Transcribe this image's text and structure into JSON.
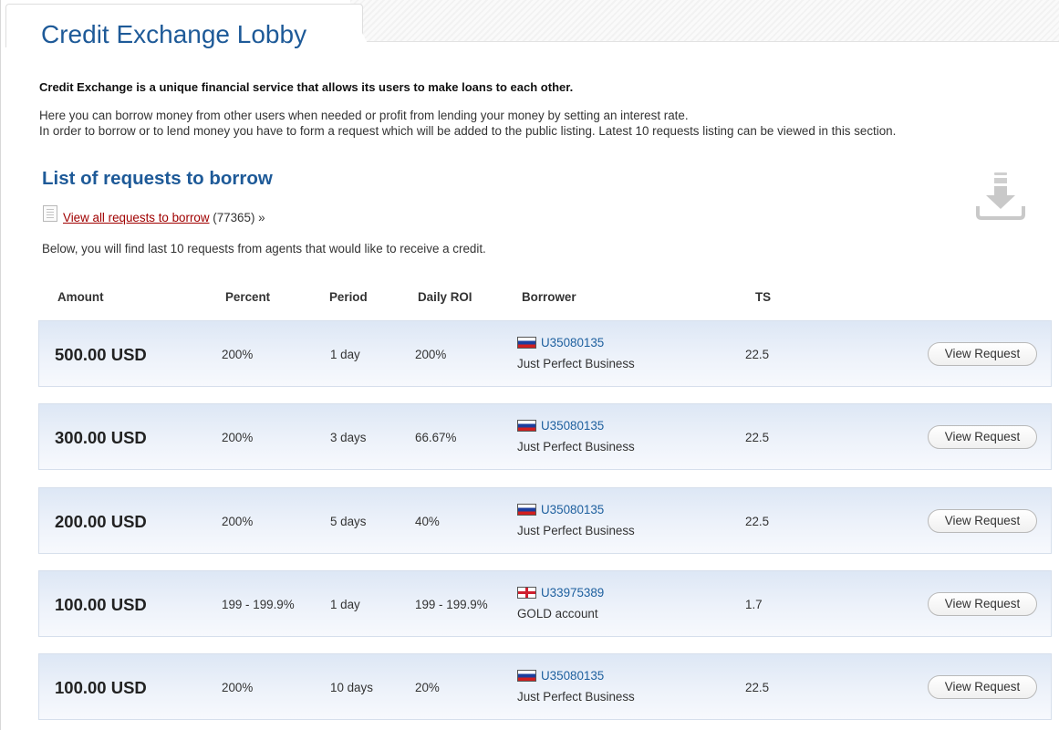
{
  "header": {
    "title": "Credit Exchange Lobby"
  },
  "intro": {
    "bold": "Credit Exchange is a unique financial service that allows its users to make loans to each other.",
    "line1": "Here you can borrow money from other users when needed or profit from lending your money by setting an interest rate.",
    "line2": "In order to borrow or to lend money you have to form a request which will be added to the public listing. Latest 10 requests listing can be viewed in this section."
  },
  "section": {
    "title": "List of requests to borrow",
    "view_all_label": "View all requests to borrow",
    "view_all_count": " (77365) »",
    "below_text": "Below, you will find last 10 requests from agents that would like to receive a credit."
  },
  "icons": {
    "document": "document-icon",
    "download": "download-arrow-icon",
    "flag_ru": "russia-flag-icon",
    "flag_en": "england-flag-icon"
  },
  "table": {
    "columns": [
      "Amount",
      "Percent",
      "Period",
      "Daily ROI",
      "Borrower",
      "TS"
    ],
    "rows": [
      {
        "amount": "500.00 USD",
        "percent": "200%",
        "period": "1 day",
        "roi": "200%",
        "flag": "ru",
        "borrower_id": "U35080135",
        "borrower_name": "Just Perfect Business",
        "ts": "22.5",
        "action": "View Request"
      },
      {
        "amount": "300.00 USD",
        "percent": "200%",
        "period": "3 days",
        "roi": "66.67%",
        "flag": "ru",
        "borrower_id": "U35080135",
        "borrower_name": "Just Perfect Business",
        "ts": "22.5",
        "action": "View Request"
      },
      {
        "amount": "200.00 USD",
        "percent": "200%",
        "period": "5 days",
        "roi": "40%",
        "flag": "ru",
        "borrower_id": "U35080135",
        "borrower_name": "Just Perfect Business",
        "ts": "22.5",
        "action": "View Request"
      },
      {
        "amount": "100.00 USD",
        "percent": "199 - 199.9%",
        "period": "1 day",
        "roi": "199 - 199.9%",
        "flag": "en",
        "borrower_id": "U33975389",
        "borrower_name": "GOLD account",
        "ts": "1.7",
        "action": "View Request"
      },
      {
        "amount": "100.00 USD",
        "percent": "200%",
        "period": "10 days",
        "roi": "20%",
        "flag": "ru",
        "borrower_id": "U35080135",
        "borrower_name": "Just Perfect Business",
        "ts": "22.5",
        "action": "View Request"
      }
    ]
  },
  "colors": {
    "title_blue": "#1e5a98",
    "link_red": "#a00000",
    "id_blue": "#1d5f9e",
    "row_bg": "#e8eef8"
  }
}
